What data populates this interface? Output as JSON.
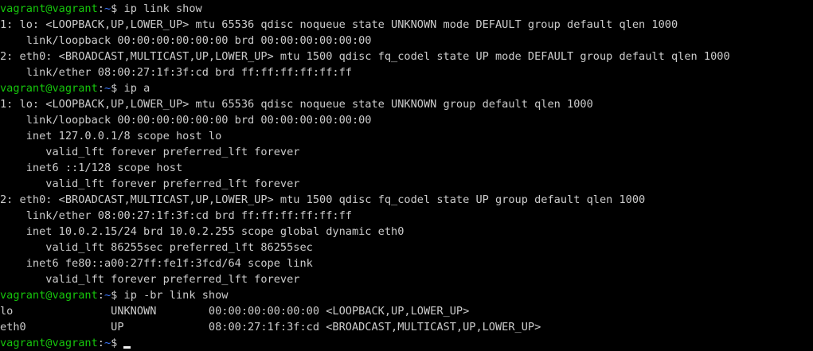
{
  "terminal": {
    "prompt": {
      "user_host": "vagrant@vagrant",
      "separator": ":",
      "path": "~",
      "dollar": "$"
    },
    "colors": {
      "background": "#000000",
      "foreground": "#cccccc",
      "prompt_user": "#16c60c",
      "prompt_path": "#3b78ff"
    },
    "lines": [
      {
        "type": "prompt",
        "command": "ip link show"
      },
      {
        "type": "output",
        "text": "1: lo: <LOOPBACK,UP,LOWER_UP> mtu 65536 qdisc noqueue state UNKNOWN mode DEFAULT group default qlen 1000"
      },
      {
        "type": "output",
        "text": "    link/loopback 00:00:00:00:00:00 brd 00:00:00:00:00:00"
      },
      {
        "type": "output",
        "text": "2: eth0: <BROADCAST,MULTICAST,UP,LOWER_UP> mtu 1500 qdisc fq_codel state UP mode DEFAULT group default qlen 1000"
      },
      {
        "type": "output",
        "text": "    link/ether 08:00:27:1f:3f:cd brd ff:ff:ff:ff:ff:ff"
      },
      {
        "type": "prompt",
        "command": "ip a"
      },
      {
        "type": "output",
        "text": "1: lo: <LOOPBACK,UP,LOWER_UP> mtu 65536 qdisc noqueue state UNKNOWN group default qlen 1000"
      },
      {
        "type": "output",
        "text": "    link/loopback 00:00:00:00:00:00 brd 00:00:00:00:00:00"
      },
      {
        "type": "output",
        "text": "    inet 127.0.0.1/8 scope host lo"
      },
      {
        "type": "output",
        "text": "       valid_lft forever preferred_lft forever"
      },
      {
        "type": "output",
        "text": "    inet6 ::1/128 scope host"
      },
      {
        "type": "output",
        "text": "       valid_lft forever preferred_lft forever"
      },
      {
        "type": "output",
        "text": "2: eth0: <BROADCAST,MULTICAST,UP,LOWER_UP> mtu 1500 qdisc fq_codel state UP group default qlen 1000"
      },
      {
        "type": "output",
        "text": "    link/ether 08:00:27:1f:3f:cd brd ff:ff:ff:ff:ff:ff"
      },
      {
        "type": "output",
        "text": "    inet 10.0.2.15/24 brd 10.0.2.255 scope global dynamic eth0"
      },
      {
        "type": "output",
        "text": "       valid_lft 86255sec preferred_lft 86255sec"
      },
      {
        "type": "output",
        "text": "    inet6 fe80::a00:27ff:fe1f:3fcd/64 scope link"
      },
      {
        "type": "output",
        "text": "       valid_lft forever preferred_lft forever"
      },
      {
        "type": "prompt",
        "command": "ip -br link show"
      },
      {
        "type": "output",
        "text": "lo               UNKNOWN        00:00:00:00:00:00 <LOOPBACK,UP,LOWER_UP>"
      },
      {
        "type": "output",
        "text": "eth0             UP             08:00:27:1f:3f:cd <BROADCAST,MULTICAST,UP,LOWER_UP>"
      },
      {
        "type": "prompt",
        "command": "",
        "cursor": true
      }
    ]
  }
}
